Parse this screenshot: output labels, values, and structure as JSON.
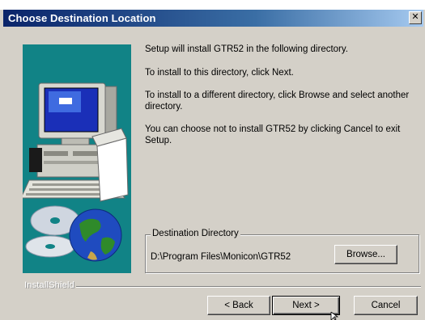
{
  "window": {
    "title": "Choose Destination Location",
    "close_glyph": "✕"
  },
  "body": {
    "line1": "Setup will install GTR52 in the following directory.",
    "line2": "To install to this directory, click Next.",
    "line3": "To install to a different directory, click Browse and select another directory.",
    "line4": "You can choose not to install GTR52 by clicking Cancel to exit Setup."
  },
  "destination": {
    "legend": "Destination Directory",
    "path": "D:\\Program Files\\Monicon\\GTR52",
    "browse_label": "Browse..."
  },
  "footer": {
    "brand": "InstallShield",
    "back_label": "< Back",
    "next_label": "Next >",
    "cancel_label": "Cancel"
  },
  "colors": {
    "title_bar": "#0a246a",
    "dialog_bg": "#d4d0c8",
    "picture_bg": "#118386"
  },
  "icons": [
    "computer-illustration",
    "cd-disc-icon",
    "globe-icon",
    "close-icon",
    "mouse-cursor-icon"
  ]
}
